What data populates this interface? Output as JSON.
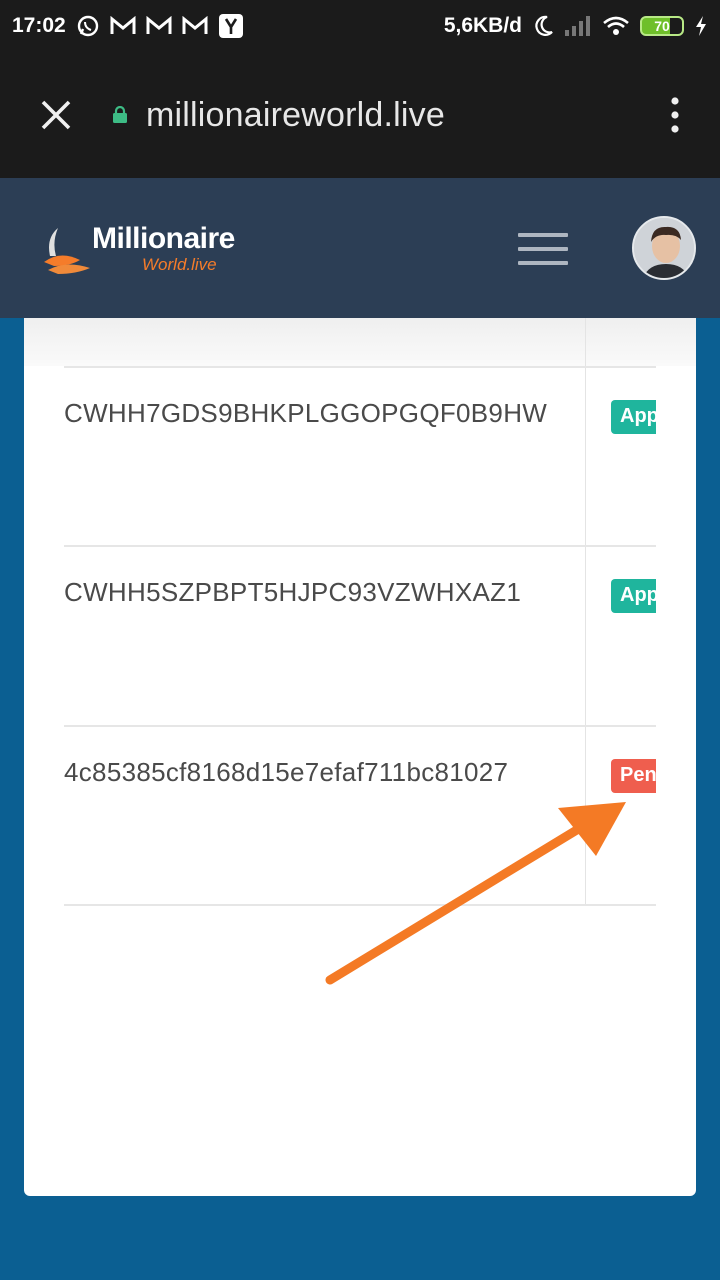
{
  "status_bar": {
    "time": "17:02",
    "network_speed": "5,6KB/d",
    "battery": "70",
    "icons": [
      "whatsapp-icon",
      "gmail-icon",
      "gmail-icon",
      "gmail-icon",
      "yandex-icon",
      "moon-icon",
      "signal-icon",
      "wifi-icon",
      "battery-icon",
      "charging-icon"
    ]
  },
  "browser": {
    "url": "millionaireworld.live",
    "close_icon": "close-icon",
    "lock_icon": "lock-icon",
    "menu_icon": "more-vert-icon"
  },
  "site": {
    "logo_main": "Millionaire",
    "logo_sub": "World.live",
    "colors": {
      "header": "#2c3e55",
      "accent": "#f57c2a",
      "approved": "#1fb59d",
      "pending": "#ef5e4e",
      "page_bg": "#0b5f92"
    }
  },
  "transactions": [
    {
      "hash": "CWHH7GDS9BHKPLGGOPGQF0B9HW",
      "status": "App",
      "status_type": "approved"
    },
    {
      "hash": "CWHH5SZPBPT5HJPC93VZWHXAZ1",
      "status": "App",
      "status_type": "approved"
    },
    {
      "hash": "4c85385cf8168d15e7efaf711bc81027",
      "status": "Pen",
      "status_type": "pending"
    }
  ]
}
